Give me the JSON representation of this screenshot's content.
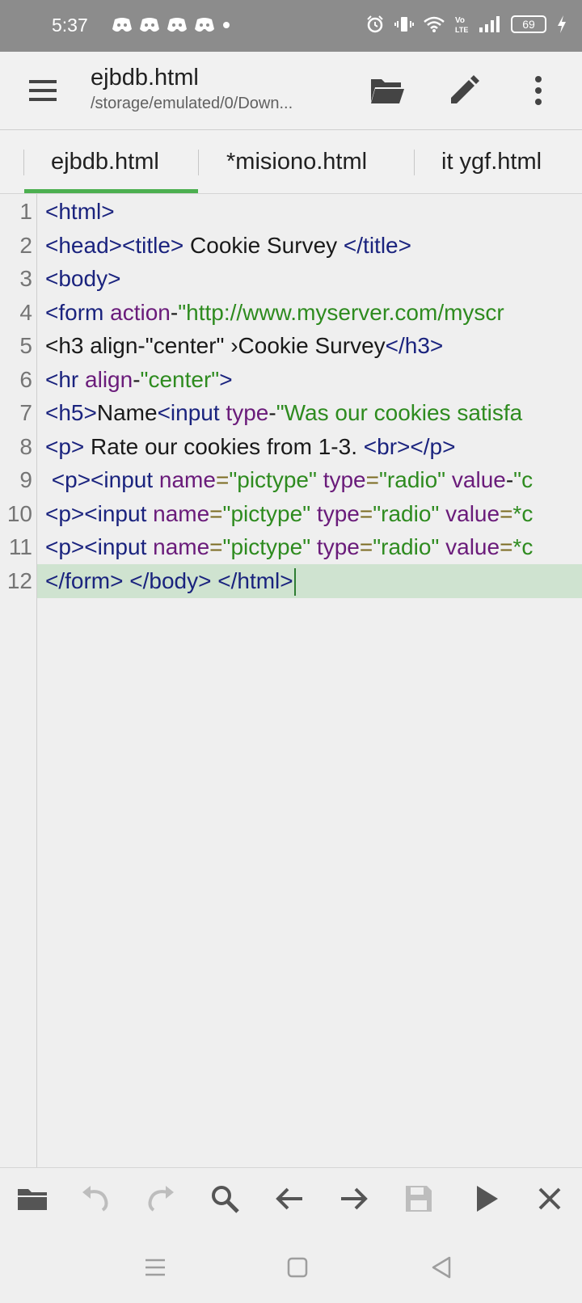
{
  "status_bar": {
    "time": "5:37",
    "battery": "69",
    "icons": [
      "discord-icon",
      "discord-icon",
      "discord-icon",
      "discord-icon",
      "dot-icon",
      "alarm-icon",
      "vibrate-icon",
      "wifi-icon",
      "volte-icon",
      "signal-icon",
      "battery-icon",
      "charging-icon"
    ]
  },
  "app_bar": {
    "title": "ejbdb.html",
    "path": "/storage/emulated/0/Down...",
    "icons": [
      "menu-icon",
      "folder-open-icon",
      "pencil-icon",
      "more-vert-icon"
    ]
  },
  "tabs": [
    {
      "label": "ejbdb.html",
      "active": true
    },
    {
      "label": "*misiono.html",
      "active": false
    },
    {
      "label": "it ygf.html",
      "active": false
    }
  ],
  "editor": {
    "line_numbers": [
      "1",
      "2",
      "3",
      "4",
      "5",
      "6",
      "7",
      "8",
      "9",
      "10",
      "11",
      "12"
    ],
    "lines": [
      [
        {
          "t": "tg",
          "v": "<html>"
        }
      ],
      [
        {
          "t": "tg",
          "v": "<head><title>"
        },
        {
          "t": "tx",
          "v": " Cookie Survey "
        },
        {
          "t": "tg",
          "v": "</title>"
        }
      ],
      [
        {
          "t": "tg",
          "v": "<body>"
        }
      ],
      [
        {
          "t": "tg",
          "v": "<form "
        },
        {
          "t": "at",
          "v": "action"
        },
        {
          "t": "tx",
          "v": "-"
        },
        {
          "t": "st",
          "v": "\"http://www.myserver.com/myscr"
        }
      ],
      [
        {
          "t": "tx",
          "v": "<h3 align-\"center\" ›Cookie Survey"
        },
        {
          "t": "tg",
          "v": "</h3>"
        }
      ],
      [
        {
          "t": "tg",
          "v": "<hr "
        },
        {
          "t": "at",
          "v": "align"
        },
        {
          "t": "tx",
          "v": "-"
        },
        {
          "t": "st",
          "v": "\"center\""
        },
        {
          "t": "tg",
          "v": ">"
        }
      ],
      [
        {
          "t": "tg",
          "v": "<h5>"
        },
        {
          "t": "tx",
          "v": "Name"
        },
        {
          "t": "tg",
          "v": "<input "
        },
        {
          "t": "at",
          "v": "type"
        },
        {
          "t": "tx",
          "v": "-"
        },
        {
          "t": "st",
          "v": "\"Was our cookies satisfa"
        }
      ],
      [
        {
          "t": "tg",
          "v": "<p>"
        },
        {
          "t": "tx",
          "v": " Rate our cookies from 1-3. "
        },
        {
          "t": "tg",
          "v": "<br></p>"
        }
      ],
      [
        {
          "t": "tx",
          "v": " "
        },
        {
          "t": "tg",
          "v": "<p><input "
        },
        {
          "t": "at",
          "v": "name"
        },
        {
          "t": "eq",
          "v": "="
        },
        {
          "t": "st",
          "v": "\"pictype\""
        },
        {
          "t": "at",
          "v": " type"
        },
        {
          "t": "eq",
          "v": "="
        },
        {
          "t": "st",
          "v": "\"radio\""
        },
        {
          "t": "at",
          "v": " value"
        },
        {
          "t": "tx",
          "v": "-"
        },
        {
          "t": "st",
          "v": "\"c"
        }
      ],
      [
        {
          "t": "tg",
          "v": "<p><input "
        },
        {
          "t": "at",
          "v": "name"
        },
        {
          "t": "eq",
          "v": "="
        },
        {
          "t": "st",
          "v": "\"pictype\""
        },
        {
          "t": "at",
          "v": " type"
        },
        {
          "t": "eq",
          "v": "="
        },
        {
          "t": "st",
          "v": "\"radio\""
        },
        {
          "t": "at",
          "v": " value"
        },
        {
          "t": "eq",
          "v": "="
        },
        {
          "t": "st",
          "v": "*c"
        }
      ],
      [
        {
          "t": "tg",
          "v": "<p><input "
        },
        {
          "t": "at",
          "v": "name"
        },
        {
          "t": "eq",
          "v": "="
        },
        {
          "t": "st",
          "v": "\"pictype\""
        },
        {
          "t": "at",
          "v": " type"
        },
        {
          "t": "eq",
          "v": "="
        },
        {
          "t": "st",
          "v": "\"radio\""
        },
        {
          "t": "at",
          "v": " value"
        },
        {
          "t": "eq",
          "v": "="
        },
        {
          "t": "st",
          "v": "*c"
        }
      ],
      [
        {
          "t": "tg",
          "v": "</form> </body> </html>"
        }
      ]
    ],
    "current_line": 12
  },
  "toolbar": {
    "icons": [
      "folder-icon",
      "undo-icon",
      "redo-icon",
      "search-icon",
      "arrow-left-icon",
      "arrow-right-icon",
      "save-icon",
      "play-icon",
      "close-icon"
    ]
  },
  "nav_bar": {
    "icons": [
      "recents-icon",
      "home-icon",
      "back-icon"
    ]
  },
  "colors": {
    "accent": "#4caf50",
    "status_bar": "#8c8c8c",
    "background": "#efefef",
    "tag": "#1a237e",
    "attribute": "#6a1b7a",
    "string": "#2e8b1f"
  }
}
